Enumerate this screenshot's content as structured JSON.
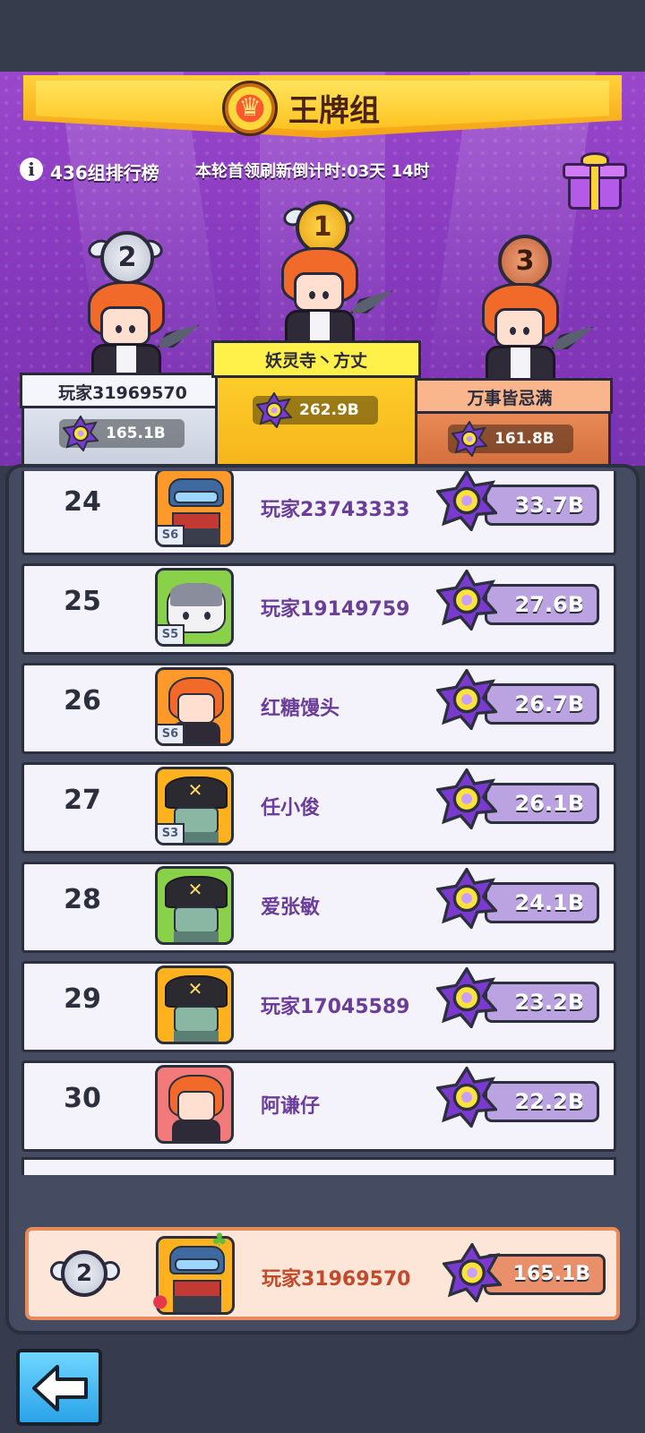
{
  "header": {
    "title": "王牌组",
    "info_text": "436组排行榜",
    "timer_text": "本轮首领刷新倒计时:03天 14时",
    "icons": [
      "info-icon",
      "gift-icon",
      "crown-emblem-icon"
    ]
  },
  "podium": {
    "first": {
      "rank": "1",
      "name": "妖灵寺丶方丈",
      "score": "262.9B"
    },
    "second": {
      "rank": "2",
      "name": "玩家31969570",
      "score": "165.1B"
    },
    "third": {
      "rank": "3",
      "name": "万事皆忌满",
      "score": "161.8B"
    }
  },
  "leaderboard": [
    {
      "rank": "24",
      "name": "玩家23743333",
      "score": "33.7B",
      "level": "S6",
      "avatar": "helmet-bandit",
      "frame": "#ff9a2a"
    },
    {
      "rank": "25",
      "name": "玩家19149759",
      "score": "27.6B",
      "level": "S5",
      "avatar": "cat",
      "frame": "#8ad14a"
    },
    {
      "rank": "26",
      "name": "红糖馒头",
      "score": "26.7B",
      "level": "S6",
      "avatar": "red-hair",
      "frame": "#ff9a2a"
    },
    {
      "rank": "27",
      "name": "任小俊",
      "score": "26.1B",
      "level": "S3",
      "avatar": "pirate-zombie",
      "frame": "#ffb21e"
    },
    {
      "rank": "28",
      "name": "爱张敏",
      "score": "24.1B",
      "level": "",
      "avatar": "pirate-zombie",
      "frame": "#8ad14a"
    },
    {
      "rank": "29",
      "name": "玩家17045589",
      "score": "23.2B",
      "level": "",
      "avatar": "pirate-zombie",
      "frame": "#ffb21e"
    },
    {
      "rank": "30",
      "name": "阿谦仔",
      "score": "22.2B",
      "level": "",
      "avatar": "red-hair",
      "frame": "#f27a7a"
    }
  ],
  "my_entry": {
    "rank": "2",
    "name": "玩家31969570",
    "score": "165.1B"
  },
  "footer": {
    "back_icon": "back-arrow-icon"
  },
  "colors": {
    "panel": "#454c62",
    "stage": "#8a3cc0",
    "score_box": "#bba2e0",
    "name_text": "#6a3e98",
    "my_highlight": "#fde6d8"
  }
}
